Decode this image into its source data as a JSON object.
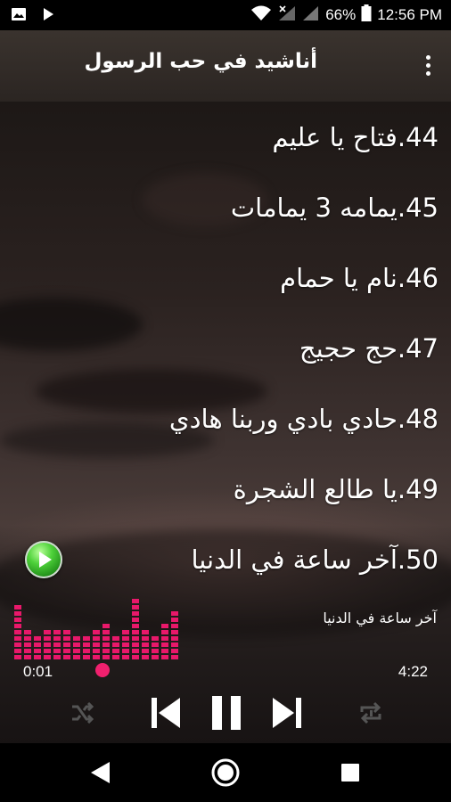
{
  "status_bar": {
    "battery_percent": "66%",
    "time": "12:56 PM"
  },
  "app_bar": {
    "title": "أناشيد في حب الرسول"
  },
  "songs": [
    {
      "label": "44.فتاح يا عليم"
    },
    {
      "label": "45.يمامه 3 يمامات"
    },
    {
      "label": "46.نام يا حمام"
    },
    {
      "label": "47.حج حجيج"
    },
    {
      "label": "48.حادي بادي وربنا هادي"
    },
    {
      "label": "49.يا طالع الشجرة"
    },
    {
      "label": "50.آخر ساعة في الدنيا"
    }
  ],
  "player": {
    "now_playing": "آخر ساعة في الدنيا",
    "elapsed": "0:01",
    "duration": "4:22",
    "accent_color": "#e8186a",
    "equalizer_levels": [
      9,
      5,
      4,
      5,
      5,
      5,
      4,
      4,
      5,
      6,
      4,
      5,
      10,
      5,
      4,
      6,
      8
    ]
  },
  "icons": {
    "shuffle": "shuffle-icon",
    "previous": "skip-previous-icon",
    "pause": "pause-icon",
    "next": "skip-next-icon",
    "repeat": "repeat-icon"
  }
}
